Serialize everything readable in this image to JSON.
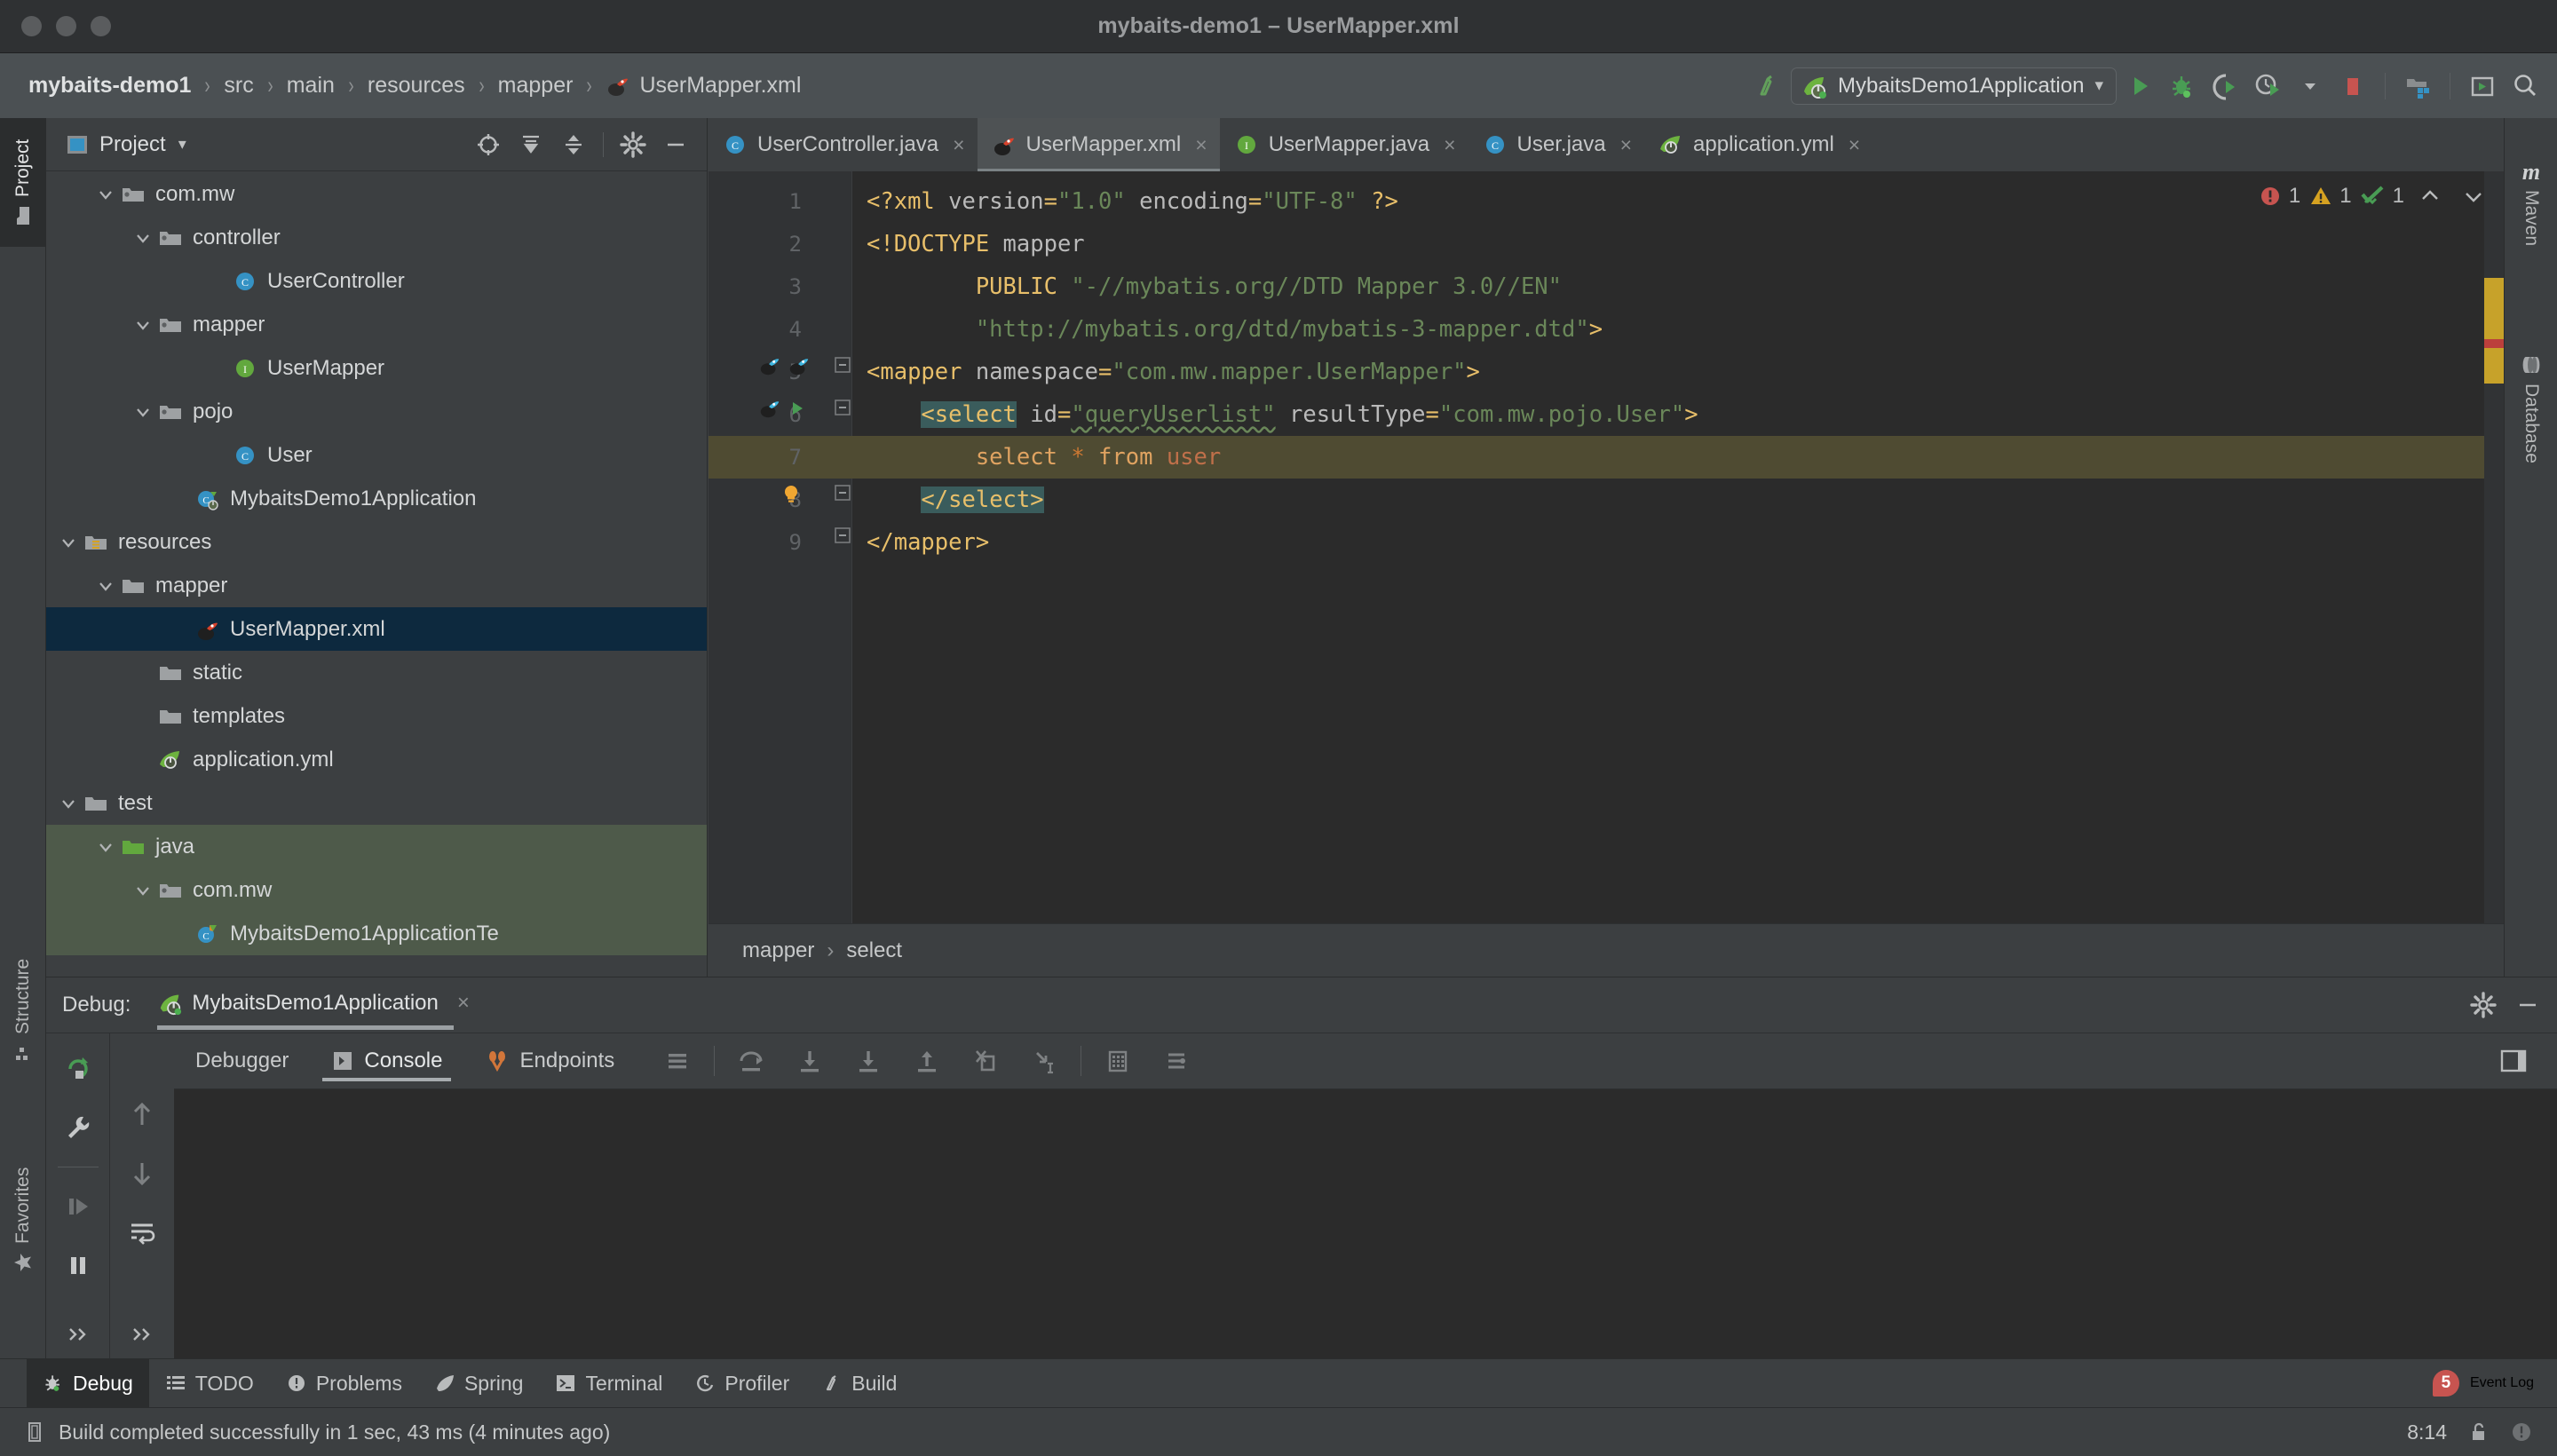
{
  "window": {
    "title": "mybaits-demo1 – UserMapper.xml",
    "traffic_lights": [
      "close",
      "minimize",
      "zoom"
    ]
  },
  "navbar": {
    "breadcrumbs": [
      {
        "label": "mybaits-demo1",
        "icon": "project-icon"
      },
      {
        "label": "src",
        "icon": "folder-icon"
      },
      {
        "label": "main",
        "icon": "folder-icon"
      },
      {
        "label": "resources",
        "icon": "folder-icon"
      },
      {
        "label": "mapper",
        "icon": "folder-icon"
      },
      {
        "label": "UserMapper.xml",
        "icon": "mybatis-file-icon"
      }
    ],
    "separator": "›",
    "run_config": {
      "label": "MybaitsDemo1Application",
      "icon": "spring-boot-icon",
      "caret": "▾"
    },
    "actions": [
      {
        "name": "build-icon",
        "tooltip": "Build"
      },
      {
        "name": "run-icon",
        "tooltip": "Run"
      },
      {
        "name": "debug-icon",
        "tooltip": "Debug"
      },
      {
        "name": "run-with-coverage-icon",
        "tooltip": "Run with Coverage"
      },
      {
        "name": "profiler-icon",
        "tooltip": "Profile"
      },
      {
        "name": "stop-icon",
        "tooltip": "Stop"
      },
      {
        "name": "project-structure-icon",
        "tooltip": "Project Structure"
      },
      {
        "name": "updates-icon",
        "tooltip": "Updates"
      },
      {
        "name": "search-icon",
        "tooltip": "Search Everywhere"
      }
    ]
  },
  "left_strip": {
    "tabs": [
      {
        "label": "Project",
        "icon": "project-folder-icon",
        "active": true
      },
      {
        "label": "Structure",
        "icon": "structure-icon",
        "active": false
      },
      {
        "label": "Favorites",
        "icon": "star-icon",
        "active": false
      }
    ]
  },
  "right_strip": {
    "tabs": [
      {
        "label": "Maven",
        "icon": "maven-icon"
      },
      {
        "label": "Database",
        "icon": "database-icon"
      }
    ]
  },
  "project_panel": {
    "title": "Project",
    "title_caret": "▾",
    "header_actions": [
      {
        "name": "locate-icon"
      },
      {
        "name": "expand-all-icon"
      },
      {
        "name": "collapse-all-icon"
      },
      {
        "name": "gear-icon"
      },
      {
        "name": "hide-icon"
      }
    ],
    "tree": [
      {
        "label": "com.mw",
        "indent": 3,
        "icon": "package-icon",
        "arrow": "down",
        "state": "normal"
      },
      {
        "label": "controller",
        "indent": 4,
        "icon": "package-icon",
        "arrow": "down",
        "state": "normal"
      },
      {
        "label": "UserController",
        "indent": 6,
        "icon": "class-icon",
        "arrow": "none",
        "state": "normal"
      },
      {
        "label": "mapper",
        "indent": 4,
        "icon": "package-icon",
        "arrow": "down",
        "state": "normal"
      },
      {
        "label": "UserMapper",
        "indent": 6,
        "icon": "interface-icon",
        "arrow": "none",
        "state": "normal"
      },
      {
        "label": "pojo",
        "indent": 4,
        "icon": "package-icon",
        "arrow": "down",
        "state": "normal"
      },
      {
        "label": "User",
        "indent": 6,
        "icon": "class-icon",
        "arrow": "none",
        "state": "normal"
      },
      {
        "label": "MybaitsDemo1Application",
        "indent": 5,
        "icon": "spring-class-icon",
        "arrow": "none",
        "state": "normal"
      },
      {
        "label": "resources",
        "indent": 2,
        "icon": "resources-folder-icon",
        "arrow": "down",
        "state": "normal"
      },
      {
        "label": "mapper",
        "indent": 3,
        "icon": "folder-icon",
        "arrow": "down",
        "state": "normal"
      },
      {
        "label": "UserMapper.xml",
        "indent": 5,
        "icon": "mybatis-file-icon",
        "arrow": "none",
        "state": "selected"
      },
      {
        "label": "static",
        "indent": 4,
        "icon": "folder-icon",
        "arrow": "none",
        "state": "normal"
      },
      {
        "label": "templates",
        "indent": 4,
        "icon": "folder-icon",
        "arrow": "none",
        "state": "normal"
      },
      {
        "label": "application.yml",
        "indent": 4,
        "icon": "spring-yml-icon",
        "arrow": "none",
        "state": "normal"
      },
      {
        "label": "test",
        "indent": 2,
        "icon": "folder-icon",
        "arrow": "down",
        "state": "normal"
      },
      {
        "label": "java",
        "indent": 3,
        "icon": "test-source-folder-icon",
        "arrow": "down",
        "state": "testsrc"
      },
      {
        "label": "com.mw",
        "indent": 4,
        "icon": "package-icon",
        "arrow": "down",
        "state": "testsrc"
      },
      {
        "label": "MybaitsDemo1ApplicationTe",
        "indent": 5,
        "icon": "test-class-icon",
        "arrow": "none",
        "state": "testsrc"
      }
    ]
  },
  "editor": {
    "tabs": [
      {
        "label": "UserController.java",
        "icon": "java-class-icon",
        "active": false,
        "close": "×"
      },
      {
        "label": "UserMapper.xml",
        "icon": "mybatis-file-icon",
        "active": true,
        "close": "×"
      },
      {
        "label": "UserMapper.java",
        "icon": "java-interface-icon",
        "active": false,
        "close": "×"
      },
      {
        "label": "User.java",
        "icon": "java-class-icon",
        "active": false,
        "close": "×"
      },
      {
        "label": "application.yml",
        "icon": "spring-yml-icon",
        "active": false,
        "close": "×"
      }
    ],
    "lines": [
      {
        "num": "1",
        "text": "<?xml version=\"1.0\" encoding=\"UTF-8\" ?>"
      },
      {
        "num": "2",
        "text": "<!DOCTYPE mapper"
      },
      {
        "num": "3",
        "text": "        PUBLIC \"-//mybatis.org//DTD Mapper 3.0//EN\""
      },
      {
        "num": "4",
        "text": "        \"http://mybatis.org/dtd/mybatis-3-mapper.dtd\">"
      },
      {
        "num": "5",
        "text": "<mapper namespace=\"com.mw.mapper.UserMapper\">"
      },
      {
        "num": "6",
        "text": "    <select id=\"queryUserlist\" resultType=\"com.mw.pojo.User\">"
      },
      {
        "num": "7",
        "text": "        select * from user"
      },
      {
        "num": "8",
        "text": "    </select>"
      },
      {
        "num": "9",
        "text": "</mapper>"
      }
    ],
    "inspections": {
      "errors": "1",
      "warnings": "1",
      "passed": "1",
      "up_arrow": "⌃",
      "down_arrow": "⌄"
    },
    "breadcrumb": {
      "items": [
        "mapper",
        "select"
      ],
      "separator": "›"
    },
    "gutter_markers": {
      "line5": [
        "mybatis-nav-icon",
        "mybatis-nav-icon"
      ],
      "line6": [
        "mybatis-nav-icon",
        "run-gutter-icon"
      ],
      "line8": [
        "intention-bulb-icon"
      ]
    }
  },
  "debug_panel": {
    "label": "Debug:",
    "session": {
      "name": "MybaitsDemo1Application",
      "icon": "spring-boot-icon",
      "close": "×"
    },
    "header_actions": [
      {
        "name": "gear-icon"
      },
      {
        "name": "hide-icon"
      }
    ],
    "side_actions": [
      {
        "name": "rerun-icon"
      },
      {
        "name": "settings-wrench-icon"
      },
      {
        "name": "resume-program-icon"
      },
      {
        "name": "pause-program-icon"
      },
      {
        "name": "more-icon"
      }
    ],
    "tool_column": [
      {
        "name": "step-up-icon"
      },
      {
        "name": "step-down-icon"
      },
      {
        "name": "soft-wrap-icon"
      },
      {
        "name": "more-icon"
      }
    ],
    "tabs": [
      {
        "label": "Debugger",
        "icon": "debugger-icon",
        "active": false
      },
      {
        "label": "Console",
        "icon": "console-icon",
        "active": true
      },
      {
        "label": "Endpoints",
        "icon": "endpoints-icon",
        "active": false
      }
    ],
    "toolbar_icons": [
      {
        "name": "frames-icon"
      },
      {
        "name": "step-over-icon"
      },
      {
        "name": "step-into-icon"
      },
      {
        "name": "force-step-into-icon"
      },
      {
        "name": "step-out-icon"
      },
      {
        "name": "drop-frame-icon"
      },
      {
        "name": "run-to-cursor-icon"
      },
      {
        "name": "evaluate-expression-icon"
      },
      {
        "name": "settings-icon"
      }
    ],
    "right_icons": [
      {
        "name": "layout-settings-icon"
      }
    ]
  },
  "status_tabs": {
    "tabs": [
      {
        "label": "Debug",
        "icon": "debug-bug-icon",
        "active": true
      },
      {
        "label": "TODO",
        "icon": "todo-icon",
        "active": false
      },
      {
        "label": "Problems",
        "icon": "problems-icon",
        "active": false
      },
      {
        "label": "Spring",
        "icon": "spring-leaf-icon",
        "active": false
      },
      {
        "label": "Terminal",
        "icon": "terminal-icon",
        "active": false
      },
      {
        "label": "Profiler",
        "icon": "profiler-icon",
        "active": false
      },
      {
        "label": "Build",
        "icon": "build-hammer-icon",
        "active": false
      }
    ],
    "event_log": {
      "label": "Event Log",
      "badge": "5"
    }
  },
  "status_bar": {
    "message": "Build completed successfully in 1 sec, 43 ms (4 minutes ago)",
    "message_icon": "memory-indicator-icon",
    "time": "8:14",
    "lock_icon": "unlock-icon",
    "notification_icon": "notification-icon"
  },
  "colors": {
    "accent_green": "#499c54",
    "error_red": "#c75450",
    "warning_yellow": "#d6a221",
    "selection_blue": "#0d293e",
    "test_source_green": "#4e5a4a",
    "editor_bg": "#2b2b2b",
    "panel_bg": "#3c3f41",
    "highlight_line": "#4f4b32"
  }
}
